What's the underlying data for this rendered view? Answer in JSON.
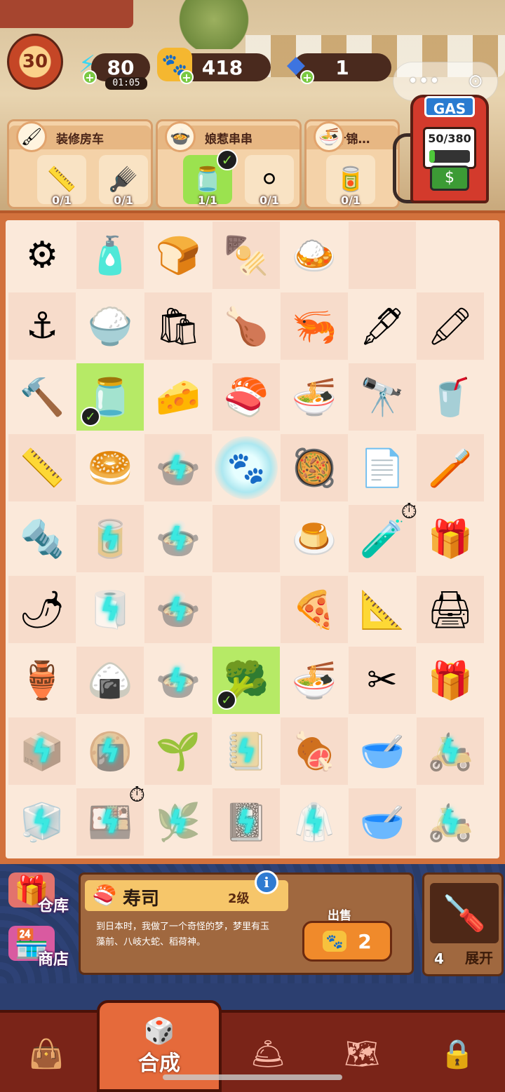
{
  "top_bar": {
    "level": "30",
    "energy": "80",
    "energy_timer": "01:05",
    "coins": "418",
    "gems": "1",
    "menu_dots": "•••",
    "close_symbol": "⊙"
  },
  "orders": [
    {
      "title": "装修房车",
      "thumb_icon": "paint-roller-icon",
      "items": [
        {
          "icon": "tape-measure-icon",
          "count": "0/1",
          "done": false
        },
        {
          "icon": "eyelash-curler-icon",
          "count": "0/1",
          "done": false
        }
      ]
    },
    {
      "title": "娘惹串串",
      "thumb_icon": "dish-icon",
      "items": [
        {
          "icon": "sauce-jar-icon",
          "count": "1/1",
          "done": true
        },
        {
          "icon": "meatball-icon",
          "count": "0/1",
          "done": false
        }
      ]
    },
    {
      "title": "什锦…",
      "thumb_icon": "noodle-bowl-icon",
      "items": [
        {
          "icon": "chili-jar-icon",
          "count": "0/1",
          "done": false
        }
      ]
    }
  ],
  "gas_station": {
    "label": "GAS",
    "fuel": "50/380",
    "fuel_level": 0.13,
    "money_icon": "cash-icon"
  },
  "board": {
    "rows": [
      [
        "tire",
        "bottle",
        "garlic-toast",
        "skewers",
        "rice-plate",
        "",
        ""
      ],
      [
        "hook",
        "rice-mat",
        "flour-bag",
        "roast-chicken",
        "shrimp-pot",
        "ink-bottle",
        "crayon-box"
      ],
      [
        "mallet",
        "sauce-jar",
        "tofu",
        "sushi",
        "noodle-bowl",
        "telescope",
        "pink-cup"
      ],
      [
        "tape-measure",
        "bun",
        "hotpot-a",
        "paw-glow",
        "curry-bowl",
        "paper",
        "brush"
      ],
      [
        "screw",
        "jar",
        "hotpot-b",
        "",
        "pudding",
        "ink-bottle-small",
        "gift-box"
      ],
      [
        "chili-sauce",
        "cloth",
        "hotpot-c",
        "",
        "pizza",
        "ruler",
        "printer"
      ],
      [
        "spice-jar",
        "seaweed-roll",
        "hotpot-d",
        "broccoli",
        "noodle-soup",
        "scissors",
        "gift-box-2"
      ],
      [
        "water-crate",
        "sushi-rolls",
        "plant",
        "notebook",
        "roast-duck",
        "jar-lid",
        "scooter"
      ],
      [
        "fridge",
        "sushi-plate",
        "herbs",
        "notebook-2",
        "chef-coat",
        "jar-lid-2",
        "scooter-2"
      ]
    ],
    "glyphs": {
      "tire": "⚙",
      "bottle": "🧴",
      "garlic-toast": "🍞",
      "skewers": "🍢",
      "rice-plate": "🍛",
      "hook": "⚓",
      "rice-mat": "🍚",
      "flour-bag": "🛍",
      "roast-chicken": "🍗",
      "shrimp-pot": "🦐",
      "ink-bottle": "🖋",
      "crayon-box": "🖍",
      "mallet": "🔨",
      "sauce-jar": "🫙",
      "tofu": "🧀",
      "sushi": "🍣",
      "noodle-bowl": "🍜",
      "telescope": "🔭",
      "pink-cup": "🥤",
      "tape-measure": "📏",
      "bun": "🥯",
      "hotpot-a": "🍲",
      "paw-glow": "🐾",
      "curry-bowl": "🥘",
      "paper": "📄",
      "brush": "🪥",
      "screw": "🔩",
      "jar": "🥫",
      "hotpot-b": "🍲",
      "pudding": "🍮",
      "ink-bottle-small": "🧪",
      "gift-box": "🎁",
      "chili-sauce": "🌶",
      "cloth": "🧻",
      "hotpot-c": "🍲",
      "pizza": "🍕",
      "ruler": "📐",
      "printer": "🖨",
      "spice-jar": "🏺",
      "seaweed-roll": "🍙",
      "hotpot-d": "🍲",
      "broccoli": "🥦",
      "noodle-soup": "🍜",
      "scissors": "✂",
      "gift-box-2": "🎁",
      "water-crate": "📦",
      "sushi-rolls": "🍘",
      "plant": "🌱",
      "notebook": "📒",
      "roast-duck": "🍖",
      "jar-lid": "🥣",
      "scooter": "🛵",
      "fridge": "🧊",
      "sushi-plate": "🍱",
      "herbs": "🌿",
      "notebook-2": "📓",
      "chef-coat": "🥼",
      "jar-lid-2": "🥣",
      "scooter-2": "🛵"
    }
  },
  "side_buttons": {
    "warehouse": "仓库",
    "shop": "商店"
  },
  "selected_item": {
    "name": "寿司",
    "level": "2级",
    "description": "到日本时，我做了一个奇怪的梦，梦里有玉藻前、八岐大蛇、稻荷神。",
    "sell_label": "出售",
    "sell_price": "2"
  },
  "tool_card": {
    "count": "4",
    "expand": "展开"
  },
  "nav": {
    "active_label": "合成"
  }
}
